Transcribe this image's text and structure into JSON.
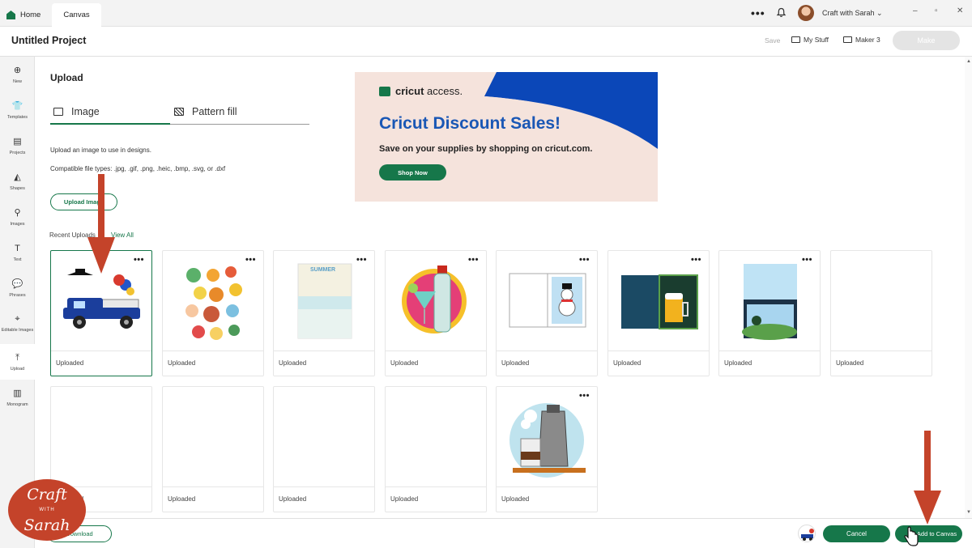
{
  "tabs": {
    "home": "Home",
    "canvas": "Canvas"
  },
  "topbar": {
    "more": "•••",
    "user": "Craft with Sarah",
    "minimize": "–",
    "restore": "▫",
    "close": "✕"
  },
  "header": {
    "title": "Untitled Project",
    "save": "Save",
    "my_stuff": "My Stuff",
    "machine": "Maker 3",
    "make": "Make"
  },
  "rail": [
    {
      "label": "New",
      "icon": "plus-circle-icon",
      "glyph": "⊕"
    },
    {
      "label": "Templates",
      "icon": "shirt-icon",
      "glyph": "👕"
    },
    {
      "label": "Projects",
      "icon": "clipboard-icon",
      "glyph": "▤"
    },
    {
      "label": "Shapes",
      "icon": "shapes-icon",
      "glyph": "◭"
    },
    {
      "label": "Images",
      "icon": "bulb-icon",
      "glyph": "⚲"
    },
    {
      "label": "Text",
      "icon": "text-icon",
      "glyph": "T"
    },
    {
      "label": "Phrases",
      "icon": "speech-bubble-icon",
      "glyph": "💬"
    },
    {
      "label": "Editable Images",
      "icon": "editable-images-icon",
      "glyph": "⌖"
    },
    {
      "label": "Upload",
      "icon": "upload-icon",
      "glyph": "⤒"
    },
    {
      "label": "Monogram",
      "icon": "monogram-icon",
      "glyph": "▥"
    }
  ],
  "upload": {
    "title": "Upload",
    "tab_image": "Image",
    "tab_pattern": "Pattern fill",
    "info1": "Upload an image to use in designs.",
    "info2": "Compatible file types: .jpg, .gif, .png, .heic, .bmp, .svg, or .dxf",
    "upload_button": "Upload Image",
    "recent_label": "Recent Uploads",
    "view_all": "View All"
  },
  "banner": {
    "logo_bold": "cricut",
    "logo_rest": " access.",
    "headline": "Cricut Discount Sales!",
    "sub": "Save on your supplies by shopping on cricut.com.",
    "cta": "Shop Now"
  },
  "cards": [
    {
      "label": "Uploaded",
      "thumb": "truck",
      "selected": true
    },
    {
      "label": "Uploaded",
      "thumb": "stickers"
    },
    {
      "label": "Uploaded",
      "thumb": "summer",
      "thumb_text": "SUMMER"
    },
    {
      "label": "Uploaded",
      "thumb": "cocktail"
    },
    {
      "label": "Uploaded",
      "thumb": "snowman-card"
    },
    {
      "label": "Uploaded",
      "thumb": "beer-card"
    },
    {
      "label": "Uploaded",
      "thumb": "landscape-card"
    },
    {
      "label": "Uploaded",
      "thumb": "blank"
    },
    {
      "label": "Uploaded",
      "thumb": "blank"
    },
    {
      "label": "Uploaded",
      "thumb": "blank"
    },
    {
      "label": "Uploaded",
      "thumb": "blank"
    },
    {
      "label": "Uploaded",
      "thumb": "blank"
    },
    {
      "label": "Uploaded",
      "thumb": "coffee"
    }
  ],
  "footer": {
    "download": "Download",
    "cancel": "Cancel",
    "add": "Add to Canvas"
  },
  "watermark": {
    "line1": "Craft",
    "with": "WITH",
    "line2": "Sarah"
  },
  "colors": {
    "accent": "#16774a",
    "banner_blue": "#1a57b5",
    "annotation_red": "#c4432a"
  }
}
